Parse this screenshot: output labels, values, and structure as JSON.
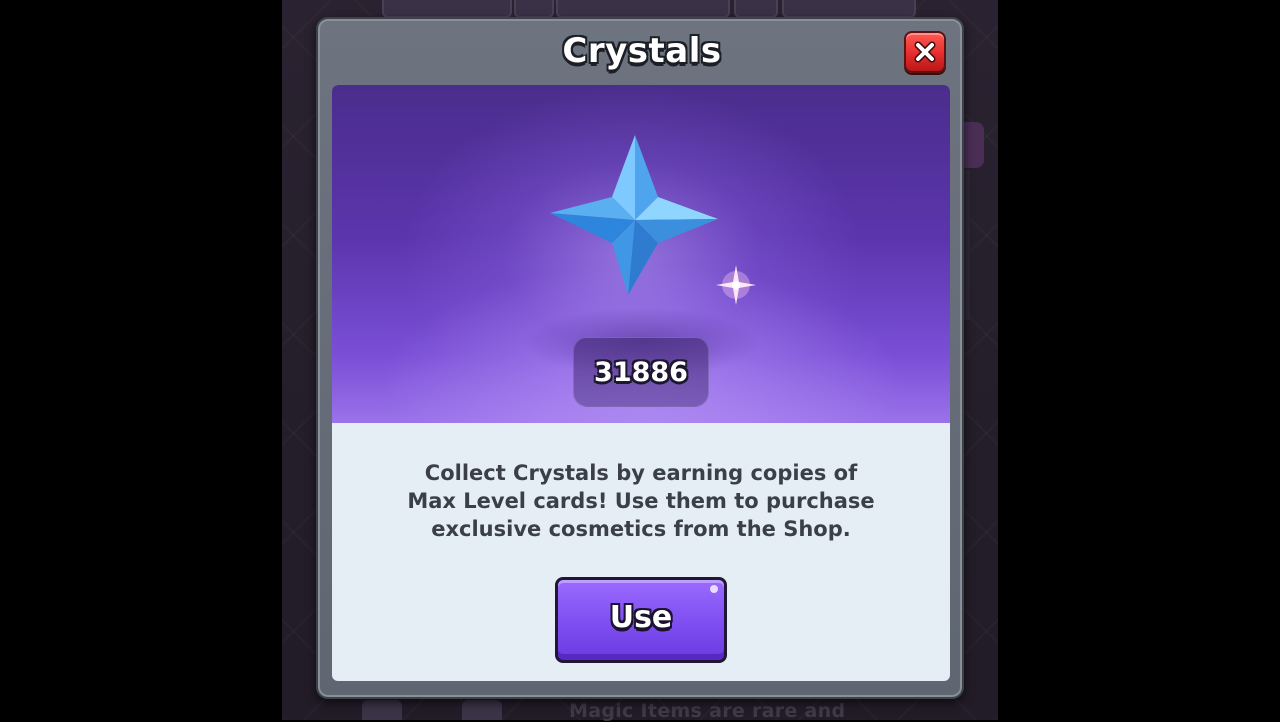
{
  "modal": {
    "title": "Crystals",
    "close_icon": "close-icon",
    "crystal_icon": "crystal-icon",
    "sparkle_icon": "sparkle-icon",
    "crystal_count": "31886",
    "description_lines": [
      "Collect Crystals by earning copies of",
      "Max Level cards! Use them to purchase",
      "exclusive cosmetics from the Shop."
    ],
    "use_button_label": "Use"
  },
  "background": {
    "bottom_text": "Magic Items are rare and"
  },
  "colors": {
    "accent_purple": "#8150f2",
    "close_red": "#e52c2c",
    "panel_light": "#e6eef5",
    "frame_gray": "#6d7480"
  }
}
